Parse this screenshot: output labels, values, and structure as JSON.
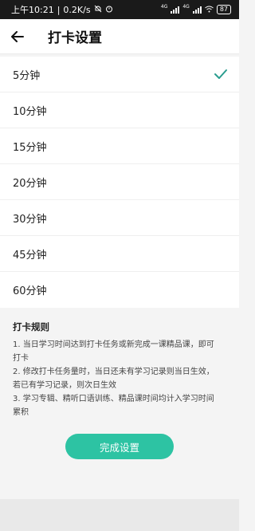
{
  "status_bar": {
    "time": "上午10:21",
    "separator": "|",
    "net_speed": "0.2K/s",
    "signal_label_1": "4G",
    "signal_label_2": "4G",
    "battery": "87"
  },
  "header": {
    "title": "打卡设置"
  },
  "options": [
    {
      "label": "5分钟",
      "selected": true
    },
    {
      "label": "10分钟",
      "selected": false
    },
    {
      "label": "15分钟",
      "selected": false
    },
    {
      "label": "20分钟",
      "selected": false
    },
    {
      "label": "30分钟",
      "selected": false
    },
    {
      "label": "45分钟",
      "selected": false
    },
    {
      "label": "60分钟",
      "selected": false
    }
  ],
  "rules": {
    "title": "打卡规则",
    "lines": [
      "1. 当日学习时间达到打卡任务或新完成一课精品课，即可",
      "打卡",
      "2. 修改打卡任务量时，当日还未有学习记录则当日生效，",
      "若已有学习记录，则次日生效",
      "3. 学习专辑、精听口语训练、精品课时间均计入学习时间",
      "累积"
    ]
  },
  "finish_button": {
    "label": "完成设置"
  },
  "colors": {
    "accent": "#2dc3a3",
    "check": "#2a9d8f"
  }
}
